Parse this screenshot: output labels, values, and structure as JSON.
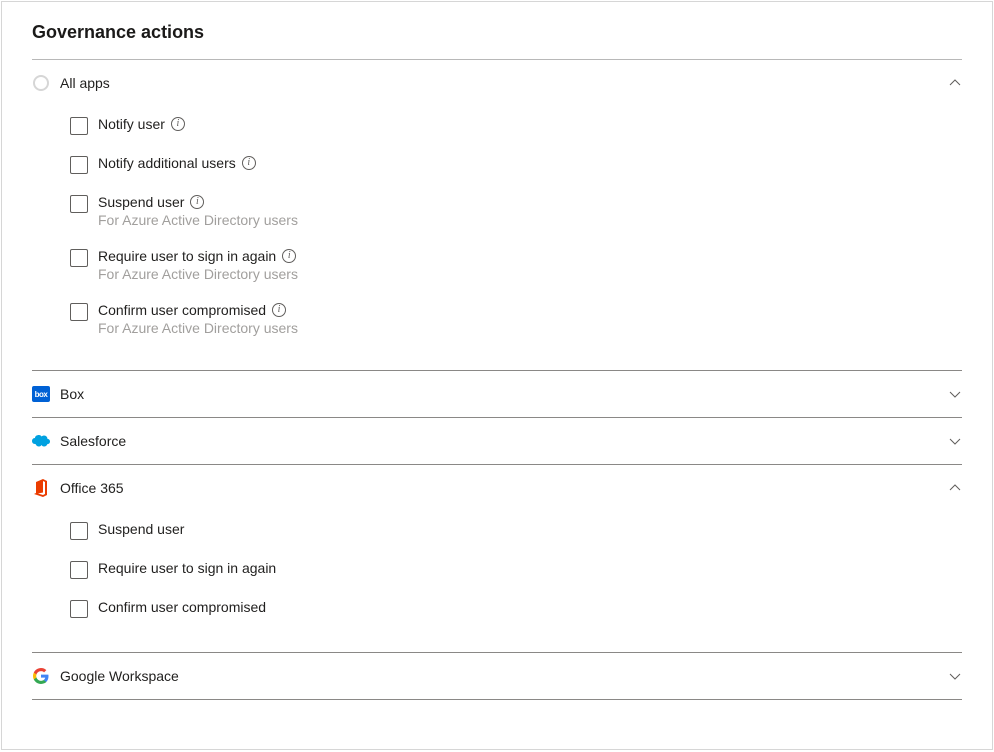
{
  "title": "Governance actions",
  "sections": [
    {
      "id": "all-apps",
      "label": "All apps",
      "expanded": true,
      "actions": [
        {
          "label": "Notify user",
          "info": true
        },
        {
          "label": "Notify additional users",
          "info": true
        },
        {
          "label": "Suspend user",
          "info": true,
          "sublabel": "For Azure Active Directory users"
        },
        {
          "label": "Require user to sign in again",
          "info": true,
          "sublabel": "For Azure Active Directory users"
        },
        {
          "label": "Confirm user compromised",
          "info": true,
          "sublabel": "For Azure Active Directory users"
        }
      ]
    },
    {
      "id": "box",
      "label": "Box",
      "expanded": false
    },
    {
      "id": "salesforce",
      "label": "Salesforce",
      "expanded": false
    },
    {
      "id": "office-365",
      "label": "Office 365",
      "expanded": true,
      "actions": [
        {
          "label": "Suspend user"
        },
        {
          "label": "Require user to sign in again"
        },
        {
          "label": "Confirm user compromised"
        }
      ]
    },
    {
      "id": "google-workspace",
      "label": "Google Workspace",
      "expanded": false
    }
  ]
}
